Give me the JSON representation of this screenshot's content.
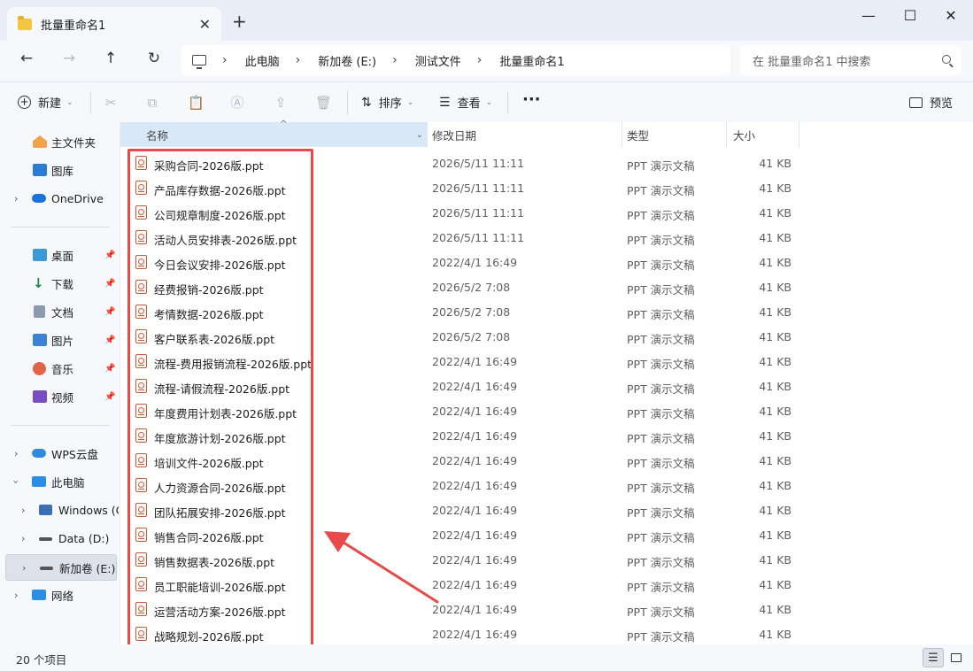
{
  "tab": {
    "title": "批量重命名1",
    "close": "✕",
    "new": "+"
  },
  "window_controls": {
    "minimize": "—",
    "maximize": "☐",
    "close": "✕"
  },
  "nav": {
    "back": "←",
    "forward": "→",
    "up": "↑",
    "refresh": "↻"
  },
  "breadcrumb": [
    "此电脑",
    "新加卷 (E:)",
    "测试文件",
    "批量重命名1"
  ],
  "search": {
    "placeholder": "在 批量重命名1 中搜索"
  },
  "toolbar": {
    "new_label": "新建",
    "sort_label": "排序",
    "view_label": "查看",
    "more_label": "···",
    "preview_label": "预览"
  },
  "sidebar": {
    "home": "主文件夹",
    "gallery": "图库",
    "onedrive": "OneDrive",
    "desktop": "桌面",
    "downloads": "下载",
    "documents": "文档",
    "pictures": "图片",
    "music": "音乐",
    "videos": "视频",
    "wps": "WPS云盘",
    "thispc": "此电脑",
    "windows": "Windows (C",
    "data": "Data (D:)",
    "newvol": "新加卷 (E:)",
    "network": "网络"
  },
  "columns": {
    "name": "名称",
    "date": "修改日期",
    "type": "类型",
    "size": "大小"
  },
  "files": [
    {
      "name": "采购合同-2026版.ppt",
      "date": "2026/5/11 11:11",
      "type": "PPT 演示文稿",
      "size": "41 KB"
    },
    {
      "name": "产品库存数据-2026版.ppt",
      "date": "2026/5/11 11:11",
      "type": "PPT 演示文稿",
      "size": "41 KB"
    },
    {
      "name": "公司规章制度-2026版.ppt",
      "date": "2026/5/11 11:11",
      "type": "PPT 演示文稿",
      "size": "41 KB"
    },
    {
      "name": "活动人员安排表-2026版.ppt",
      "date": "2026/5/11 11:11",
      "type": "PPT 演示文稿",
      "size": "41 KB"
    },
    {
      "name": "今日会议安排-2026版.ppt",
      "date": "2022/4/1 16:49",
      "type": "PPT 演示文稿",
      "size": "41 KB"
    },
    {
      "name": "经费报销-2026版.ppt",
      "date": "2026/5/2 7:08",
      "type": "PPT 演示文稿",
      "size": "41 KB"
    },
    {
      "name": "考情数据-2026版.ppt",
      "date": "2026/5/2 7:08",
      "type": "PPT 演示文稿",
      "size": "41 KB"
    },
    {
      "name": "客户联系表-2026版.ppt",
      "date": "2026/5/2 7:08",
      "type": "PPT 演示文稿",
      "size": "41 KB"
    },
    {
      "name": "流程-费用报销流程-2026版.ppt",
      "date": "2022/4/1 16:49",
      "type": "PPT 演示文稿",
      "size": "41 KB"
    },
    {
      "name": "流程-请假流程-2026版.ppt",
      "date": "2022/4/1 16:49",
      "type": "PPT 演示文稿",
      "size": "41 KB"
    },
    {
      "name": "年度费用计划表-2026版.ppt",
      "date": "2022/4/1 16:49",
      "type": "PPT 演示文稿",
      "size": "41 KB"
    },
    {
      "name": "年度旅游计划-2026版.ppt",
      "date": "2022/4/1 16:49",
      "type": "PPT 演示文稿",
      "size": "41 KB"
    },
    {
      "name": "培训文件-2026版.ppt",
      "date": "2022/4/1 16:49",
      "type": "PPT 演示文稿",
      "size": "41 KB"
    },
    {
      "name": "人力资源合同-2026版.ppt",
      "date": "2022/4/1 16:49",
      "type": "PPT 演示文稿",
      "size": "41 KB"
    },
    {
      "name": "团队拓展安排-2026版.ppt",
      "date": "2022/4/1 16:49",
      "type": "PPT 演示文稿",
      "size": "41 KB"
    },
    {
      "name": "销售合同-2026版.ppt",
      "date": "2022/4/1 16:49",
      "type": "PPT 演示文稿",
      "size": "41 KB"
    },
    {
      "name": "销售数据表-2026版.ppt",
      "date": "2022/4/1 16:49",
      "type": "PPT 演示文稿",
      "size": "41 KB"
    },
    {
      "name": "员工职能培训-2026版.ppt",
      "date": "2022/4/1 16:49",
      "type": "PPT 演示文稿",
      "size": "41 KB"
    },
    {
      "name": "运营活动方案-2026版.ppt",
      "date": "2022/4/1 16:49",
      "type": "PPT 演示文稿",
      "size": "41 KB"
    },
    {
      "name": "战略规划-2026版.ppt",
      "date": "2022/4/1 16:49",
      "type": "PPT 演示文稿",
      "size": "41 KB"
    }
  ],
  "status": {
    "item_count": "20 个项目"
  },
  "colors": {
    "highlight": "#e84a4a",
    "header_active": "#d9e8f7",
    "ppt_icon": "#d0583a"
  }
}
